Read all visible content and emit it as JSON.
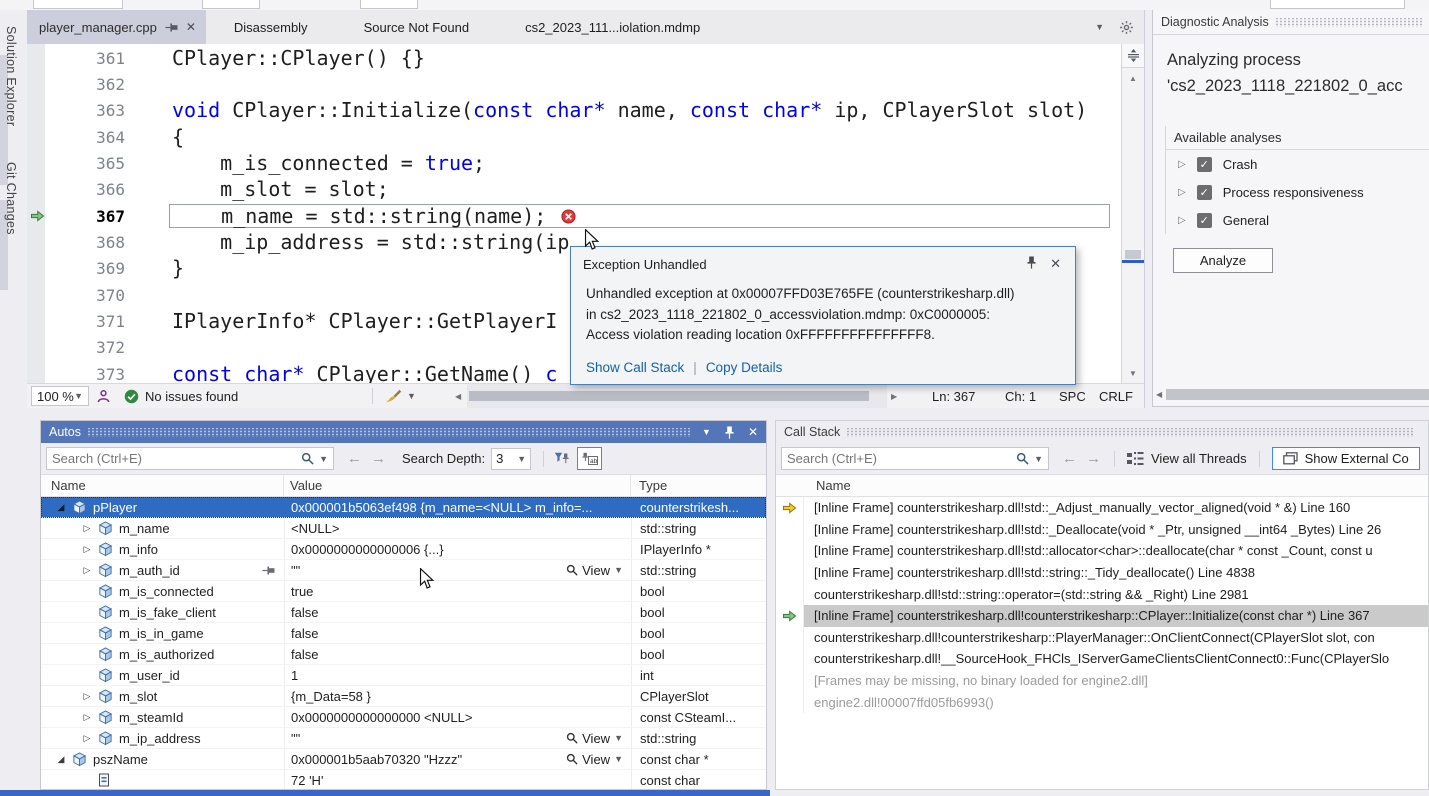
{
  "sidebar": {
    "items": [
      "Solution Explorer",
      "Git Changes"
    ]
  },
  "editor": {
    "tabs": [
      {
        "label": "player_manager.cpp",
        "active": true
      },
      {
        "label": "Disassembly",
        "active": false
      },
      {
        "label": "Source Not Found",
        "active": false
      },
      {
        "label": "cs2_2023_111...iolation.mdmp",
        "active": false
      }
    ],
    "code": [
      {
        "num": "361",
        "seg": [
          [
            "n",
            "CPlayer::CPlayer() {}"
          ]
        ]
      },
      {
        "num": "362",
        "seg": []
      },
      {
        "num": "363",
        "seg": [
          [
            "k",
            "void"
          ],
          [
            "n",
            " CPlayer::Initialize("
          ],
          [
            "k",
            "const"
          ],
          [
            "n",
            " "
          ],
          [
            "k",
            "char*"
          ],
          [
            "n",
            " name, "
          ],
          [
            "k",
            "const"
          ],
          [
            "n",
            " "
          ],
          [
            "k",
            "char*"
          ],
          [
            "n",
            " ip, CPlayerSlot slot)"
          ]
        ]
      },
      {
        "num": "364",
        "seg": [
          [
            "n",
            "{"
          ]
        ]
      },
      {
        "num": "365",
        "seg": [
          [
            "n",
            "    m_is_connected = "
          ],
          [
            "k",
            "true"
          ],
          [
            "n",
            ";"
          ]
        ]
      },
      {
        "num": "366",
        "seg": [
          [
            "n",
            "    m_slot = slot;"
          ]
        ]
      },
      {
        "num": "367",
        "seg": [
          [
            "n",
            "    m_name = std::string(name);"
          ]
        ],
        "current": true,
        "error": true
      },
      {
        "num": "368",
        "seg": [
          [
            "n",
            "    m_ip_address = std::string(ip"
          ]
        ]
      },
      {
        "num": "369",
        "seg": [
          [
            "n",
            "}"
          ]
        ]
      },
      {
        "num": "370",
        "seg": []
      },
      {
        "num": "371",
        "seg": [
          [
            "n",
            "IPlayerInfo* CPlayer::GetPlayerI"
          ]
        ]
      },
      {
        "num": "372",
        "seg": []
      },
      {
        "num": "373",
        "seg": [
          [
            "k",
            "const"
          ],
          [
            "n",
            " "
          ],
          [
            "k",
            "char*"
          ],
          [
            "n",
            " CPlayer::GetName() "
          ],
          [
            "k",
            "c"
          ]
        ]
      }
    ],
    "status": {
      "zoom": "100 %",
      "issues": "No issues found",
      "ln": "Ln: 367",
      "ch": "Ch: 1",
      "spc": "SPC",
      "eol": "CRLF"
    }
  },
  "popup": {
    "title": "Exception Unhandled",
    "line1": "Unhandled exception at 0x00007FFD03E765FE (counterstrikesharp.dll)",
    "line2": "in cs2_2023_1118_221802_0_accessviolation.mdmp: 0xC0000005:",
    "line3": "Access violation reading location 0xFFFFFFFFFFFFFFF8.",
    "link1": "Show Call Stack",
    "link2": "Copy Details"
  },
  "diagnostic": {
    "title": "Diagnostic Analysis",
    "heading_line1": "Analyzing process",
    "heading_line2": "'cs2_2023_1118_221802_0_acc",
    "section": "Available analyses",
    "analyses": [
      {
        "label": "Crash",
        "checked": true
      },
      {
        "label": "Process responsiveness",
        "checked": true
      },
      {
        "label": "General",
        "checked": true
      }
    ],
    "analyze_button": "Analyze"
  },
  "autos": {
    "title": "Autos",
    "search_placeholder": "Search (Ctrl+E)",
    "depth_label": "Search Depth:",
    "depth_value": "3",
    "view_label": "View",
    "columns": [
      "Name",
      "Value",
      "Type"
    ],
    "rows": [
      {
        "name": "pPlayer",
        "value": "0x000001b5063ef498 {m_name=<NULL> m_info=...",
        "type": "counterstrikesh...",
        "level": 0,
        "expand": "open",
        "selected": true
      },
      {
        "name": "m_name",
        "value": "<NULL>",
        "type": "std::string",
        "level": 1,
        "expand": "closed"
      },
      {
        "name": "m_info",
        "value": "0x0000000000000006 {...}",
        "type": "IPlayerInfo *",
        "level": 1,
        "expand": "closed"
      },
      {
        "name": "m_auth_id",
        "value": "\"\"",
        "type": "std::string",
        "level": 1,
        "expand": "closed",
        "pin": true,
        "view": true
      },
      {
        "name": "m_is_connected",
        "value": "true",
        "type": "bool",
        "level": 1
      },
      {
        "name": "m_is_fake_client",
        "value": "false",
        "type": "bool",
        "level": 1
      },
      {
        "name": "m_is_in_game",
        "value": "false",
        "type": "bool",
        "level": 1
      },
      {
        "name": "m_is_authorized",
        "value": "false",
        "type": "bool",
        "level": 1
      },
      {
        "name": "m_user_id",
        "value": "1",
        "type": "int",
        "level": 1
      },
      {
        "name": "m_slot",
        "value": "{m_Data=58 }",
        "type": "CPlayerSlot",
        "level": 1,
        "expand": "closed"
      },
      {
        "name": "m_steamId",
        "value": "0x0000000000000000 <NULL>",
        "type": "const CSteamI...",
        "level": 1,
        "expand": "closed"
      },
      {
        "name": "m_ip_address",
        "value": "\"\"",
        "type": "std::string",
        "level": 1,
        "expand": "closed",
        "view": true
      },
      {
        "name": "pszName",
        "value": "0x000001b5aab70320 \"Hzzz\"",
        "type": "const char *",
        "level": 0,
        "expand": "open",
        "view": true
      },
      {
        "name": "",
        "value": "72 'H'",
        "type": "const char",
        "level": 1,
        "icon": "char"
      }
    ]
  },
  "callstack": {
    "title": "Call Stack",
    "search_placeholder": "Search (Ctrl+E)",
    "view_all_threads": "View all Threads",
    "show_external": "Show External Co",
    "column": "Name",
    "frames": [
      {
        "text": "[Inline Frame] counterstrikesharp.dll!std::_Adjust_manually_vector_aligned(void * &) Line 160",
        "arrow": "yellow"
      },
      {
        "text": "[Inline Frame] counterstrikesharp.dll!std::_Deallocate(void * _Ptr, unsigned __int64 _Bytes) Line 26"
      },
      {
        "text": "[Inline Frame] counterstrikesharp.dll!std::allocator<char>::deallocate(char * const _Count, const u"
      },
      {
        "text": "[Inline Frame] counterstrikesharp.dll!std::string::_Tidy_deallocate() Line 4838"
      },
      {
        "text": "counterstrikesharp.dll!std::string::operator=(std::string && _Right) Line 2981"
      },
      {
        "text": "[Inline Frame] counterstrikesharp.dll!counterstrikesharp::CPlayer::Initialize(const char *) Line 367",
        "arrow": "green",
        "selected": true
      },
      {
        "text": "counterstrikesharp.dll!counterstrikesharp::PlayerManager::OnClientConnect(CPlayerSlot slot, con"
      },
      {
        "text": "counterstrikesharp.dll!__SourceHook_FHCls_IServerGameClientsClientConnect0::Func(CPlayerSlo"
      },
      {
        "text": "[Frames may be missing, no binary loaded for engine2.dll]",
        "gray": true
      },
      {
        "text": "engine2.dll!00007ffd05fb6993()",
        "gray": true
      }
    ]
  }
}
